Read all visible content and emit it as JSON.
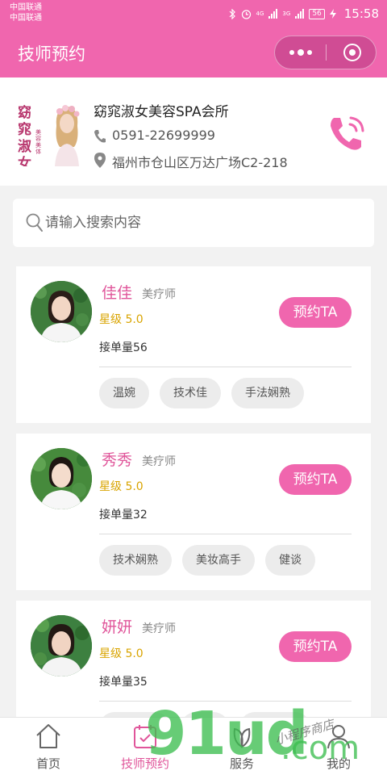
{
  "status_bar": {
    "carrier1": "中国联通",
    "carrier2": "中国联通",
    "net1": "4G",
    "net2": "3G",
    "battery": "56",
    "time": "15:58"
  },
  "navbar": {
    "title": "技师预约"
  },
  "shop": {
    "logo_text": "窈窕淑女",
    "logo_sub": "美容美体",
    "name": "窈窕淑女美容SPA会所",
    "phone": "0591-22699999",
    "address": "福州市仓山区万达广场C2-218"
  },
  "search": {
    "placeholder": "请输入搜索内容"
  },
  "technicians": [
    {
      "name": "佳佳",
      "role": "美疗师",
      "rating": "星级 5.0",
      "orders": "接单量56",
      "button": "预约TA",
      "tags": [
        "温婉",
        "技术佳",
        "手法娴熟"
      ]
    },
    {
      "name": "秀秀",
      "role": "美疗师",
      "rating": "星级 5.0",
      "orders": "接单量32",
      "button": "预约TA",
      "tags": [
        "技术娴熟",
        "美妆高手",
        "健谈"
      ]
    },
    {
      "name": "妍妍",
      "role": "美疗师",
      "rating": "星级 5.0",
      "orders": "接单量35",
      "button": "预约TA",
      "tags": [
        "",
        "",
        ""
      ]
    }
  ],
  "tabbar": {
    "items": [
      {
        "label": "首页",
        "icon": "home-icon"
      },
      {
        "label": "技师预约",
        "icon": "calendar-check-icon"
      },
      {
        "label": "服务",
        "icon": "leaf-icon"
      },
      {
        "label": "我的",
        "icon": "user-icon"
      }
    ],
    "active_index": 1
  },
  "watermark": {
    "main": "91ud",
    "suffix": ".com",
    "handwritten": "小程序商店"
  },
  "colors": {
    "brand_pink": "#f066ae",
    "name_pink": "#e0559a",
    "rating_gold": "#d9a400"
  }
}
